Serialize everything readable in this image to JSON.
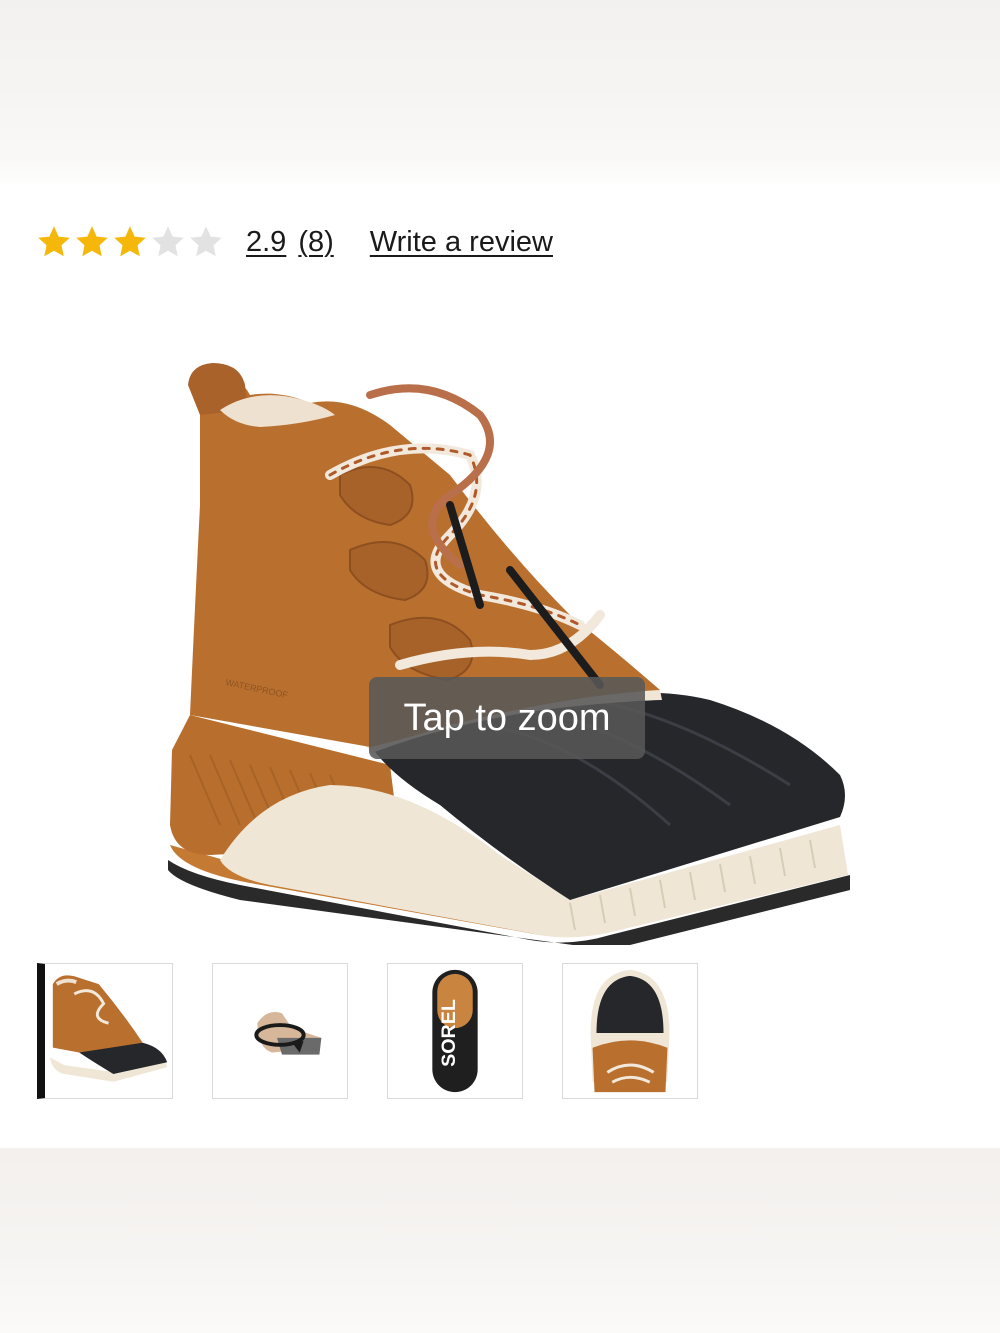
{
  "rating": {
    "value_text": "2.9",
    "count_text": "(8)",
    "stars_filled": 3,
    "stars_total": 5,
    "star_color": "#f5b70a",
    "star_empty_color": "#e2e2e2"
  },
  "review_link": {
    "label": "Write a review"
  },
  "gallery": {
    "zoom_hint": "Tap to zoom",
    "main_image": {
      "icon": "boot-photo",
      "embossed_text": "WATERPROOF"
    },
    "thumbnails": [
      {
        "icon": "boot-side-thumbnail",
        "selected": true
      },
      {
        "icon": "rotate-360-icon",
        "selected": false
      },
      {
        "icon": "sole-thumbnail",
        "brand_text": "SOREL",
        "selected": false
      },
      {
        "icon": "toe-top-thumbnail",
        "selected": false
      }
    ]
  }
}
